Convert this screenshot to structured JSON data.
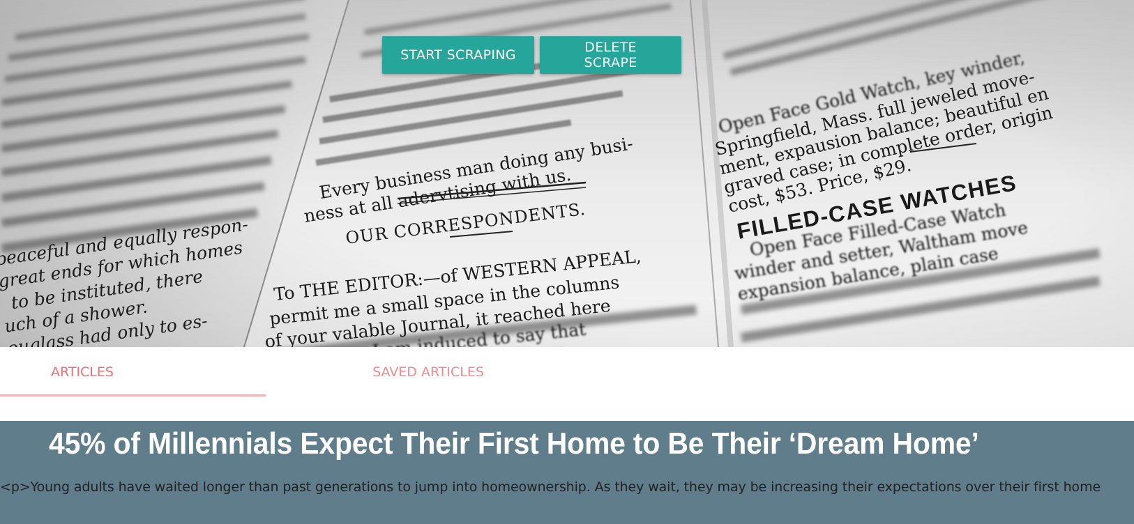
{
  "hero": {
    "buttons": {
      "start_label": "START SCRAPING",
      "delete_label": "DELETE SCRAPE"
    },
    "background_image": {
      "column_left": [
        "peaceful and equally respon-",
        "great ends for which homes",
        "to  be  instituted,  there",
        "uch of a shower.",
        "ouglass had only to  es-"
      ],
      "column_middle": [
        "Every business man doing any busi-",
        "ness at all adervtising with us.",
        "OUR CORRESPONDENTS.",
        "To THE EDITOR:—of WESTERN APPEAL,",
        "permit  me a small space in the columns",
        "of your valable Journal, it reached here",
        "in due time. I am induced to say that"
      ],
      "column_right": [
        "Open Face Gold Watch, key winder,",
        "Springfield, Mass. full jeweled move-",
        "ment, expausion balance; beautiful en",
        "graved case; in complete order, origin",
        "cost, $53.   Price, $29.",
        "FILLED-CASE WATCHES",
        "Open Face Filled-Case Watch",
        "winder and setter, Waltham move",
        "expansion balance, plain case"
      ]
    }
  },
  "tabs": [
    {
      "label": "ARTICLES",
      "active": true
    },
    {
      "label": "SAVED ARTICLES",
      "active": false
    }
  ],
  "article": {
    "title": "45% of Millennials Expect Their First Home to Be Their ‘Dream Home’",
    "summary": "<p>Young adults have waited longer than past generations to jump into homeownership. As they wait, they may be increasing their expectations over their first home"
  },
  "colors": {
    "button": "#26a69a",
    "tab_text": "#ee6e73",
    "tab_indicator": "#f6b2b5",
    "article_bg": "#607d8b"
  }
}
